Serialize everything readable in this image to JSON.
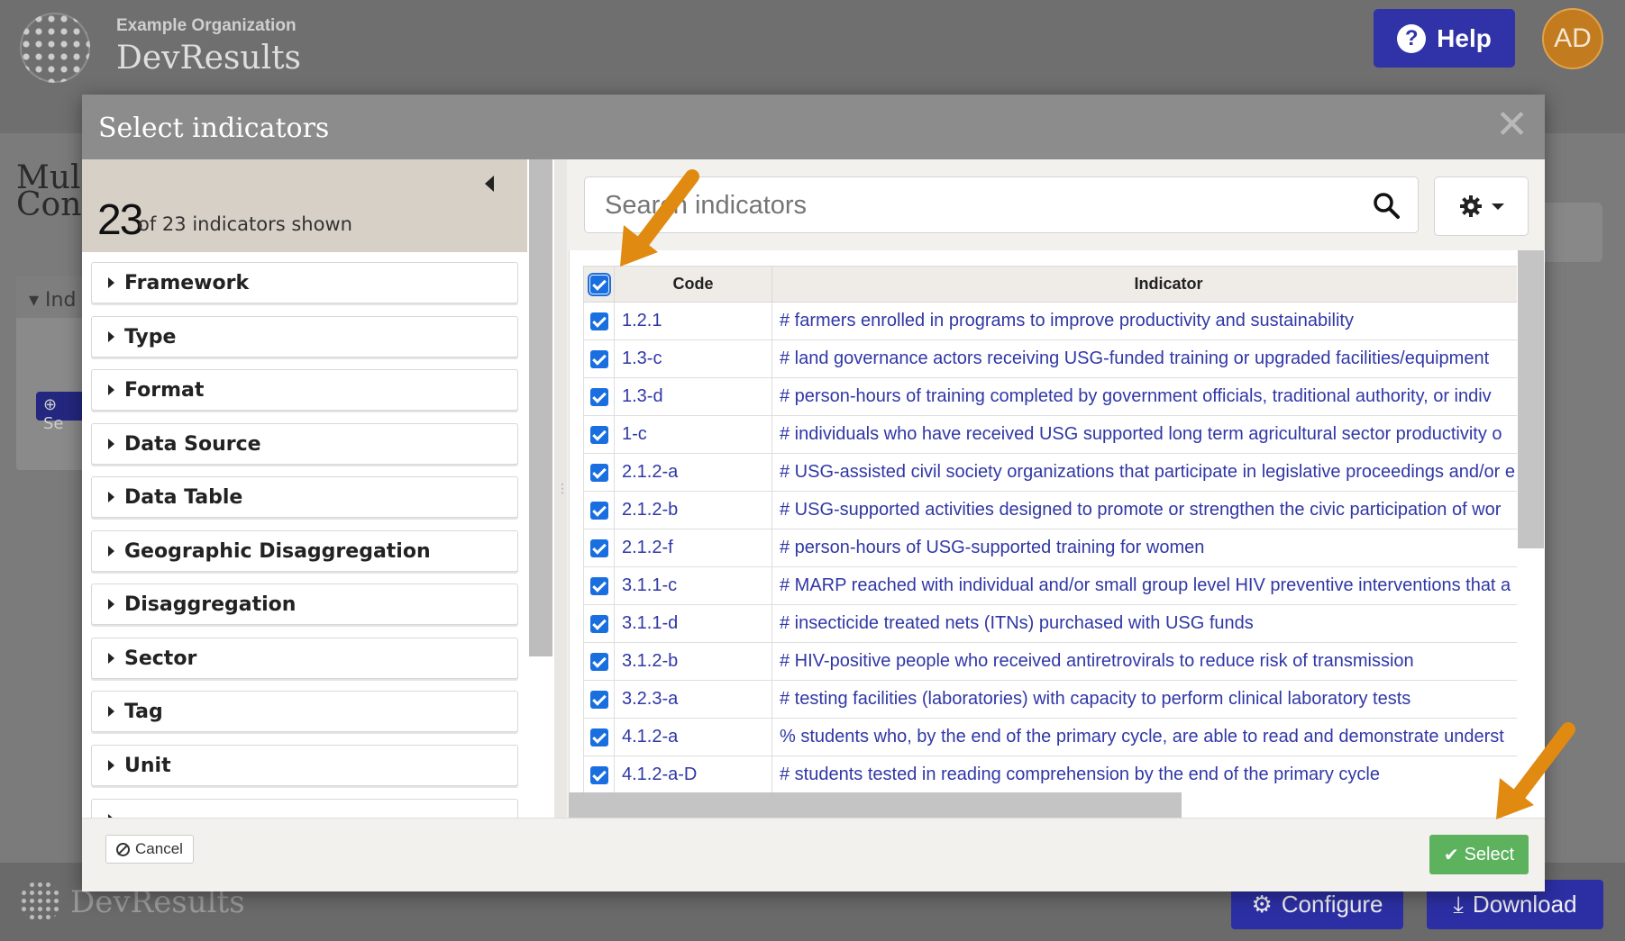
{
  "app": {
    "org_name": "Example Organization",
    "app_name": "DevResults",
    "help_label": "Help",
    "avatar_initials": "AD"
  },
  "background": {
    "page_title_line1": "Mul",
    "page_title_line2": "Conf",
    "panel_header": "Ind",
    "add_button": "Se"
  },
  "footer": {
    "brand": "DevResults",
    "configure_label": "Configure",
    "download_label": "Download"
  },
  "modal": {
    "title": "Select indicators",
    "close_glyph": "✕",
    "count": {
      "shown": "23",
      "text": "of 23 indicators shown"
    },
    "filters": [
      "Framework",
      "Type",
      "Format",
      "Data Source",
      "Data Table",
      "Geographic Disaggregation",
      "Disaggregation",
      "Sector",
      "Tag",
      "Unit"
    ],
    "search": {
      "placeholder": "Search indicators",
      "value": ""
    },
    "table": {
      "headers": {
        "code": "Code",
        "indicator": "Indicator"
      },
      "rows": [
        {
          "code": "1.2.1",
          "indicator": "# farmers enrolled in programs to improve productivity and sustainability",
          "checked": true
        },
        {
          "code": "1.3-c",
          "indicator": "# land governance actors receiving USG-funded training or upgraded facilities/equipment",
          "checked": true
        },
        {
          "code": "1.3-d",
          "indicator": "# person-hours of training completed by government officials, traditional authority, or indiv",
          "checked": true
        },
        {
          "code": "1-c",
          "indicator": "# individuals who have received USG supported long term agricultural sector productivity o",
          "checked": true
        },
        {
          "code": "2.1.2-a",
          "indicator": "# USG-assisted civil society organizations that participate in legislative proceedings and/or e",
          "checked": true
        },
        {
          "code": "2.1.2-b",
          "indicator": "# USG-supported activities designed to promote or strengthen the civic participation of wor",
          "checked": true
        },
        {
          "code": "2.1.2-f",
          "indicator": "# person-hours of USG-supported training for women",
          "checked": true
        },
        {
          "code": "3.1.1-c",
          "indicator": "# MARP reached with individual and/or small group level HIV preventive interventions that a",
          "checked": true
        },
        {
          "code": "3.1.1-d",
          "indicator": "# insecticide treated nets (ITNs) purchased with USG funds",
          "checked": true
        },
        {
          "code": "3.1.2-b",
          "indicator": "# HIV-positive people who received antiretrovirals to reduce risk of transmission",
          "checked": true
        },
        {
          "code": "3.2.3-a",
          "indicator": "# testing facilities (laboratories) with capacity to perform clinical laboratory tests",
          "checked": true
        },
        {
          "code": "4.1.2-a",
          "indicator": "% students who, by the end of the primary cycle, are able to read and demonstrate underst",
          "checked": true
        },
        {
          "code": "4.1.2-a-D",
          "indicator": "# students tested in reading comprehension by the end of the primary cycle",
          "checked": true
        }
      ]
    },
    "cancel_label": "Cancel",
    "select_label": "Select"
  },
  "colors": {
    "accent_blue": "#2f33a7",
    "link_blue": "#3037a6",
    "checkbox_blue": "#1a6fe0",
    "select_green": "#5cb25d",
    "annotation_orange": "#e08a12",
    "avatar_orange": "#c27b1f"
  }
}
